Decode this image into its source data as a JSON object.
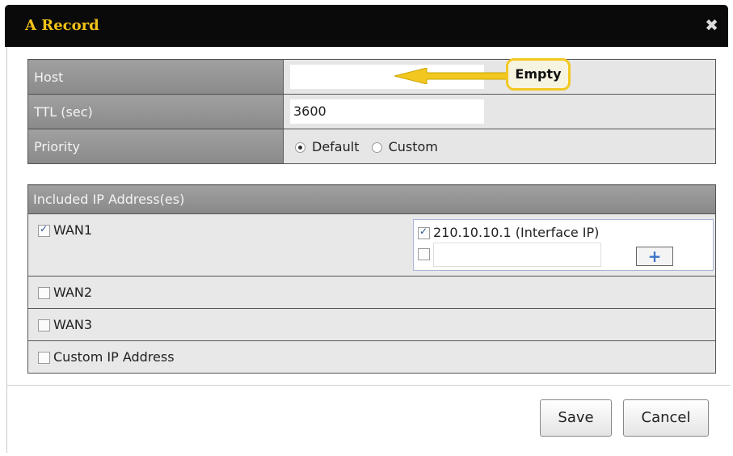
{
  "dialog": {
    "title": "A Record",
    "close_glyph": "✖"
  },
  "form": {
    "host_label": "Host",
    "host_value": "",
    "ttl_label": "TTL (sec)",
    "ttl_value": "3600",
    "priority_label": "Priority",
    "priority_options": [
      {
        "label": "Default",
        "selected": true
      },
      {
        "label": "Custom",
        "selected": false
      }
    ]
  },
  "annotation": {
    "callout_text": "Empty",
    "arrow_color": "#f2c820"
  },
  "ips": {
    "header": "Included IP Address(es)",
    "rows": [
      {
        "label": "WAN1",
        "checked": true
      },
      {
        "label": "WAN2",
        "checked": false
      },
      {
        "label": "WAN3",
        "checked": false
      },
      {
        "label": "Custom IP Address",
        "checked": false
      }
    ],
    "wan1_ips": [
      {
        "label": "210.10.10.1 (Interface IP)",
        "checked": true
      },
      {
        "label": "",
        "checked": false
      }
    ],
    "add_glyph": "+"
  },
  "buttons": {
    "save": "Save",
    "cancel": "Cancel"
  },
  "colors": {
    "title_text": "#f3c318",
    "titlebar_bg": "#0a0a0a",
    "label_bg": "#999999",
    "callout_border": "#f2c820"
  }
}
